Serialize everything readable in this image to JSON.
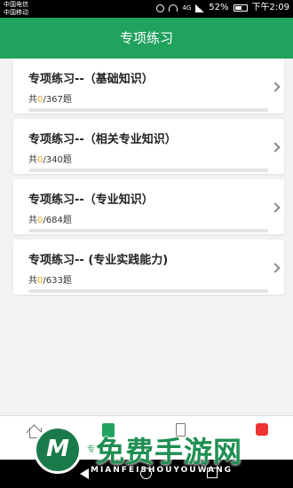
{
  "status_bar": {
    "carrier1": "中国电信",
    "carrier2": "中国移动",
    "signal_text": "4G",
    "battery_percent": "52%",
    "time": "下午2:09"
  },
  "header": {
    "title": "专项练习"
  },
  "cards": [
    {
      "title": "专项练习--（基础知识）",
      "prefix": "共",
      "done": "0",
      "total": "/367题",
      "progress": 0
    },
    {
      "title": "专项练习--（相关专业知识）",
      "prefix": "共",
      "done": "0",
      "total": "/340题",
      "progress": 0
    },
    {
      "title": "专项练习--（专业知识）",
      "prefix": "共",
      "done": "0",
      "total": "/684题",
      "progress": 0
    },
    {
      "title": "专项练习-- (专业实践能力)",
      "prefix": "共",
      "done": "0",
      "total": "/633题",
      "progress": 0
    }
  ],
  "tab_bar": {
    "active_label": "专",
    "icons": [
      "home-icon",
      "practice-icon",
      "document-icon",
      "badge-icon"
    ]
  },
  "watermark": {
    "logo_letter": "M",
    "text": "免费手游网",
    "sub": "MIANFEISHOUYOUWANG"
  },
  "colors": {
    "accent": "#21a25e",
    "done_count": "#f0a020"
  }
}
